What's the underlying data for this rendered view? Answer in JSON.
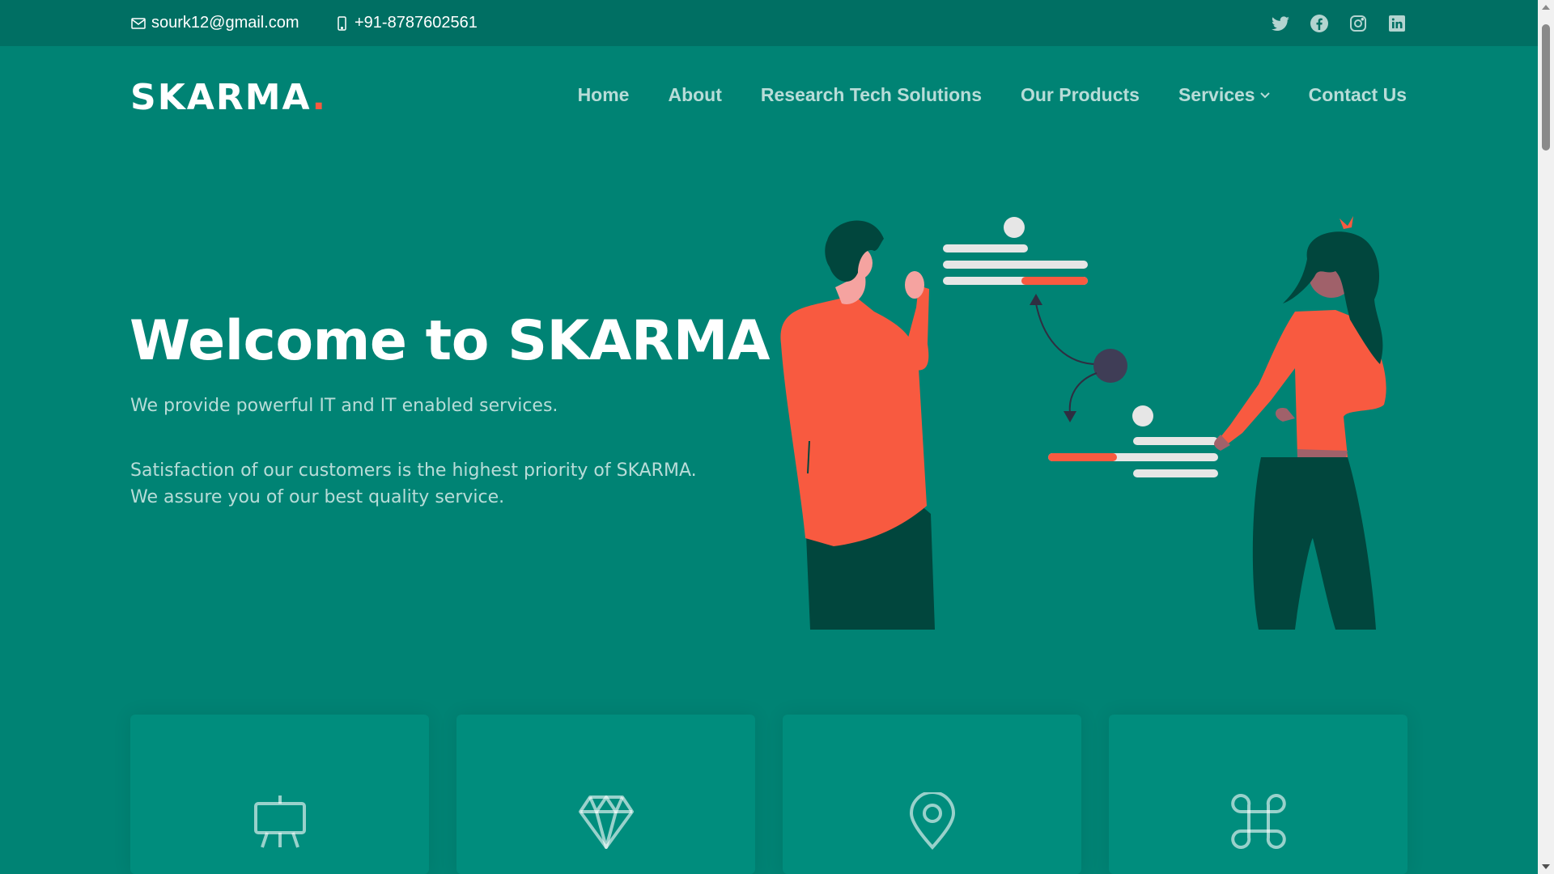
{
  "topbar": {
    "email": "sourk12@gmail.com",
    "phone": "+91-8787602561",
    "socials": [
      "twitter-icon",
      "facebook-icon",
      "instagram-icon",
      "linkedin-icon"
    ]
  },
  "header": {
    "logo_text": "SKARMA",
    "logo_dot": ".",
    "nav": {
      "home": "Home",
      "about": "About",
      "research": "Research Tech Solutions",
      "products": "Our Products",
      "services": "Services",
      "contact": "Contact Us"
    }
  },
  "hero": {
    "title": "Welcome to SKARMA",
    "subtitle": "We provide powerful IT and IT enabled services.",
    "text": "Satisfaction of our customers is the highest priority of SKARMA. We assure you of our best quality service."
  },
  "cards": {
    "icons": [
      "easel-icon",
      "gem-icon",
      "location-pin-icon",
      "command-icon"
    ]
  },
  "colors": {
    "background": "#008374",
    "topbar": "#006f63",
    "card": "#008d7d",
    "accent": "#f85a40"
  }
}
